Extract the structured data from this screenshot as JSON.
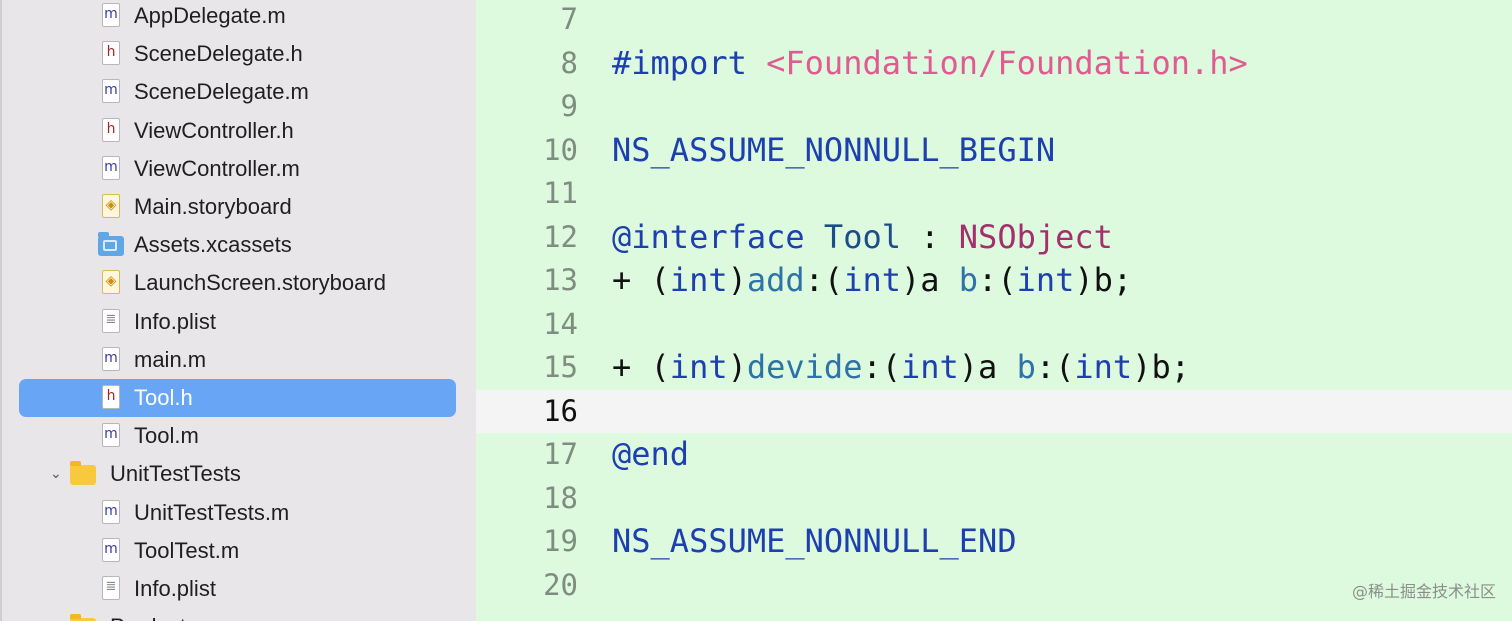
{
  "navigator": {
    "items": [
      {
        "label": "AppDelegate.m",
        "icon": "m-file-icon",
        "icon_glyph": "m",
        "kind": "m"
      },
      {
        "label": "SceneDelegate.h",
        "icon": "h-file-icon",
        "icon_glyph": "h",
        "kind": "h"
      },
      {
        "label": "SceneDelegate.m",
        "icon": "m-file-icon",
        "icon_glyph": "m",
        "kind": "m"
      },
      {
        "label": "ViewController.h",
        "icon": "h-file-icon",
        "icon_glyph": "h",
        "kind": "h"
      },
      {
        "label": "ViewController.m",
        "icon": "m-file-icon",
        "icon_glyph": "m",
        "kind": "m"
      },
      {
        "label": "Main.storyboard",
        "icon": "storyboard-file-icon",
        "icon_glyph": "◈",
        "kind": "storyboard"
      },
      {
        "label": "Assets.xcassets",
        "icon": "asset-catalog-folder-icon",
        "icon_glyph": "",
        "kind": "assets"
      },
      {
        "label": "LaunchScreen.storyboard",
        "icon": "storyboard-file-icon",
        "icon_glyph": "◈",
        "kind": "storyboard"
      },
      {
        "label": "Info.plist",
        "icon": "plist-file-icon",
        "icon_glyph": "≣",
        "kind": "plist"
      },
      {
        "label": "main.m",
        "icon": "m-file-icon",
        "icon_glyph": "m",
        "kind": "m"
      },
      {
        "label": "Tool.h",
        "icon": "h-file-icon",
        "icon_glyph": "h",
        "kind": "h",
        "selected": true
      },
      {
        "label": "Tool.m",
        "icon": "m-file-icon",
        "icon_glyph": "m",
        "kind": "m"
      },
      {
        "label": "UnitTestTests",
        "icon": "folder-icon",
        "icon_glyph": "",
        "kind": "group",
        "expanded": true,
        "disclosure_glyph": "⌄"
      },
      {
        "label": "UnitTestTests.m",
        "icon": "m-file-icon",
        "icon_glyph": "m",
        "kind": "m"
      },
      {
        "label": "ToolTest.m",
        "icon": "m-file-icon",
        "icon_glyph": "m",
        "kind": "m"
      },
      {
        "label": "Info.plist",
        "icon": "plist-file-icon",
        "icon_glyph": "≣",
        "kind": "plist"
      },
      {
        "label": "Products",
        "icon": "folder-icon",
        "icon_glyph": "",
        "kind": "group",
        "expanded": false,
        "disclosure_glyph": "›"
      }
    ]
  },
  "editor": {
    "current_line": 16,
    "lines": [
      {
        "number": "7",
        "tokens": []
      },
      {
        "number": "8",
        "tokens": [
          {
            "text": "#import ",
            "class": "kw"
          },
          {
            "text": "<Foundation/Foundation.h>",
            "class": "str"
          }
        ]
      },
      {
        "number": "9",
        "tokens": []
      },
      {
        "number": "10",
        "tokens": [
          {
            "text": "NS_ASSUME_NONNULL_BEGIN",
            "class": "macro"
          }
        ]
      },
      {
        "number": "11",
        "tokens": []
      },
      {
        "number": "12",
        "tokens": [
          {
            "text": "@interface",
            "class": "kw"
          },
          {
            "text": " ",
            "class": "plain"
          },
          {
            "text": "Tool",
            "class": "type"
          },
          {
            "text": " : ",
            "class": "plain"
          },
          {
            "text": "NSObject",
            "class": "class"
          }
        ]
      },
      {
        "number": "13",
        "tokens": [
          {
            "text": "+ (",
            "class": "plain"
          },
          {
            "text": "int",
            "class": "kw"
          },
          {
            "text": ")",
            "class": "plain"
          },
          {
            "text": "add",
            "class": "method"
          },
          {
            "text": ":(",
            "class": "plain"
          },
          {
            "text": "int",
            "class": "kw"
          },
          {
            "text": ")a ",
            "class": "plain"
          },
          {
            "text": "b",
            "class": "method"
          },
          {
            "text": ":(",
            "class": "plain"
          },
          {
            "text": "int",
            "class": "kw"
          },
          {
            "text": ")b;",
            "class": "plain"
          }
        ]
      },
      {
        "number": "14",
        "tokens": []
      },
      {
        "number": "15",
        "tokens": [
          {
            "text": "+ (",
            "class": "plain"
          },
          {
            "text": "int",
            "class": "kw"
          },
          {
            "text": ")",
            "class": "plain"
          },
          {
            "text": "devide",
            "class": "method"
          },
          {
            "text": ":(",
            "class": "plain"
          },
          {
            "text": "int",
            "class": "kw"
          },
          {
            "text": ")a ",
            "class": "plain"
          },
          {
            "text": "b",
            "class": "method"
          },
          {
            "text": ":(",
            "class": "plain"
          },
          {
            "text": "int",
            "class": "kw"
          },
          {
            "text": ")b;",
            "class": "plain"
          }
        ]
      },
      {
        "number": "16",
        "tokens": []
      },
      {
        "number": "17",
        "tokens": [
          {
            "text": "@end",
            "class": "kw"
          }
        ]
      },
      {
        "number": "18",
        "tokens": []
      },
      {
        "number": "19",
        "tokens": [
          {
            "text": "NS_ASSUME_NONNULL_END",
            "class": "macro"
          }
        ]
      },
      {
        "number": "20",
        "tokens": []
      }
    ]
  },
  "watermark": "@稀土掘金技术社区",
  "colors": {
    "editor_background": "#ddfadf",
    "current_line_background": "#f4f4f4",
    "selection": "#69a5f5",
    "keyword": "#1d3fb0",
    "string": "#e15a91",
    "class_name": "#a3306d"
  }
}
